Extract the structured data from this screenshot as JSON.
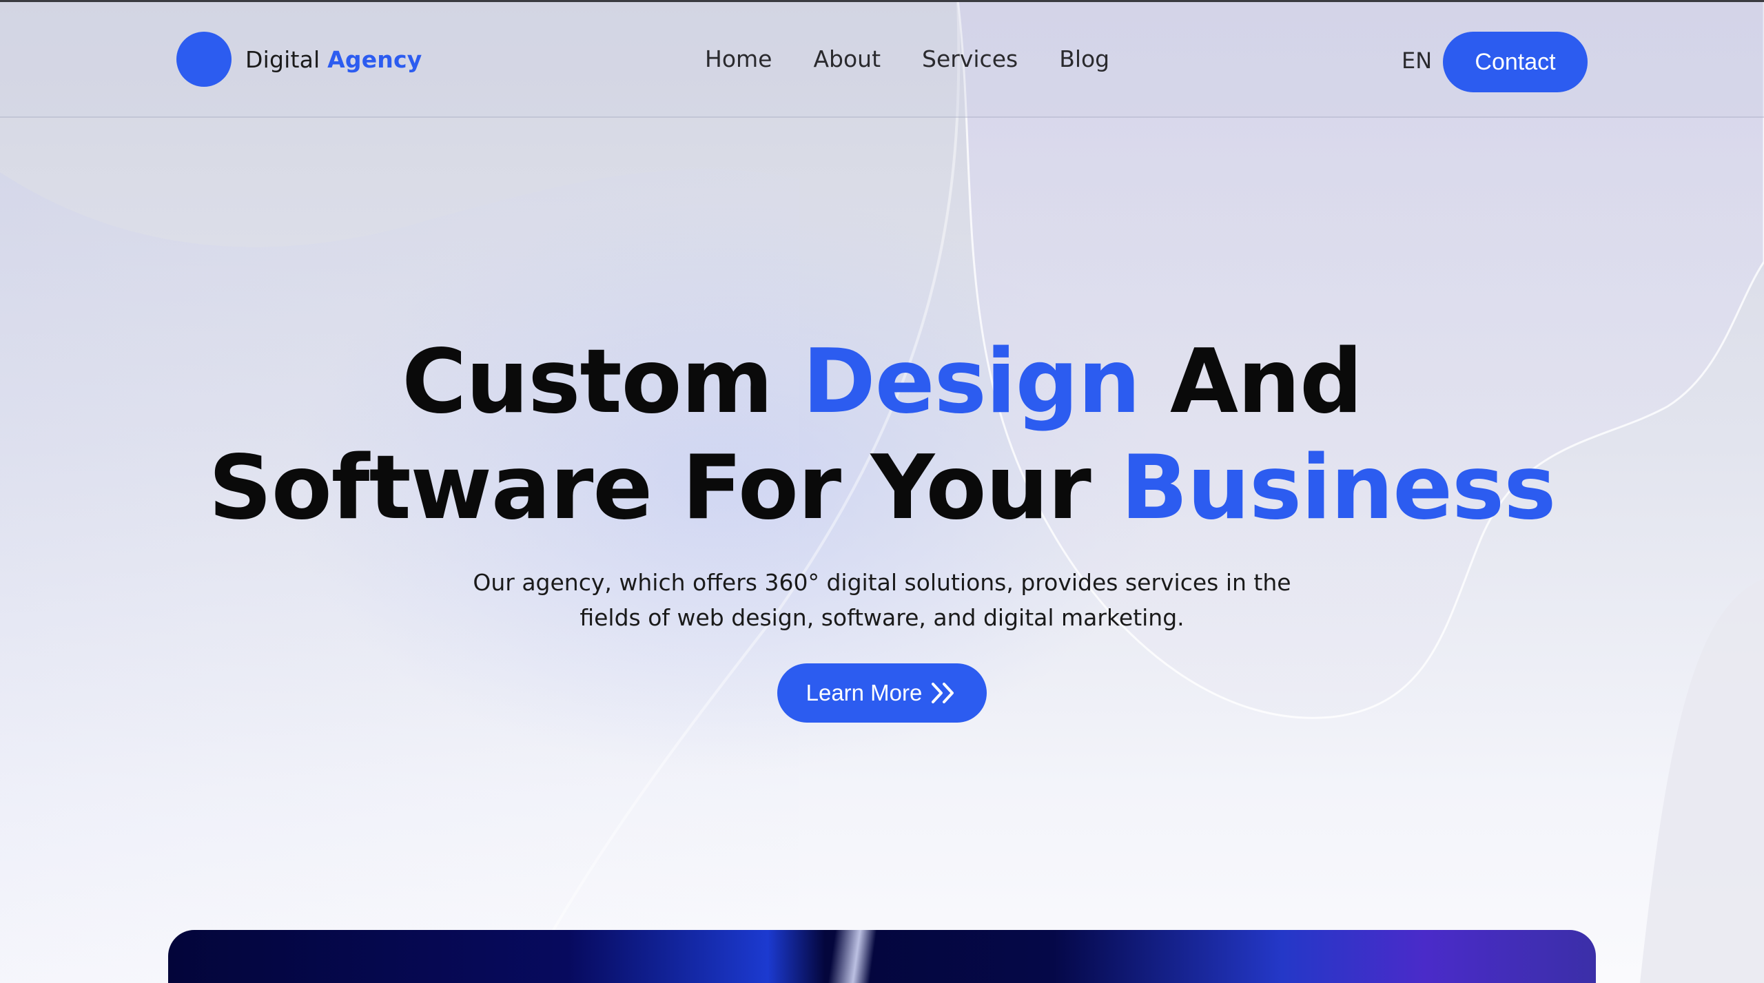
{
  "header": {
    "logo": {
      "icon": "logo-circle",
      "text_plain": "Digital",
      "text_accent": "Agency"
    },
    "nav": [
      {
        "label": "Home"
      },
      {
        "label": "About"
      },
      {
        "label": "Services"
      },
      {
        "label": "Blog"
      }
    ],
    "language": "EN",
    "contact_label": "Contact"
  },
  "hero": {
    "title_line1": {
      "part1": "Custom ",
      "accent": "Design",
      "part2": " And"
    },
    "title_line2": {
      "part1": "Software For Your ",
      "accent": "Business"
    },
    "subtitle": "Our agency, which offers 360° digital solutions, provides services in the fields of web design, software, and digital marketing.",
    "cta_label": "Learn More",
    "cta_icon": "double-chevron-right-icon"
  },
  "colors": {
    "accent": "#2c5cf0",
    "text": "#0a0a0a",
    "showcase_dark": "#03053a"
  }
}
